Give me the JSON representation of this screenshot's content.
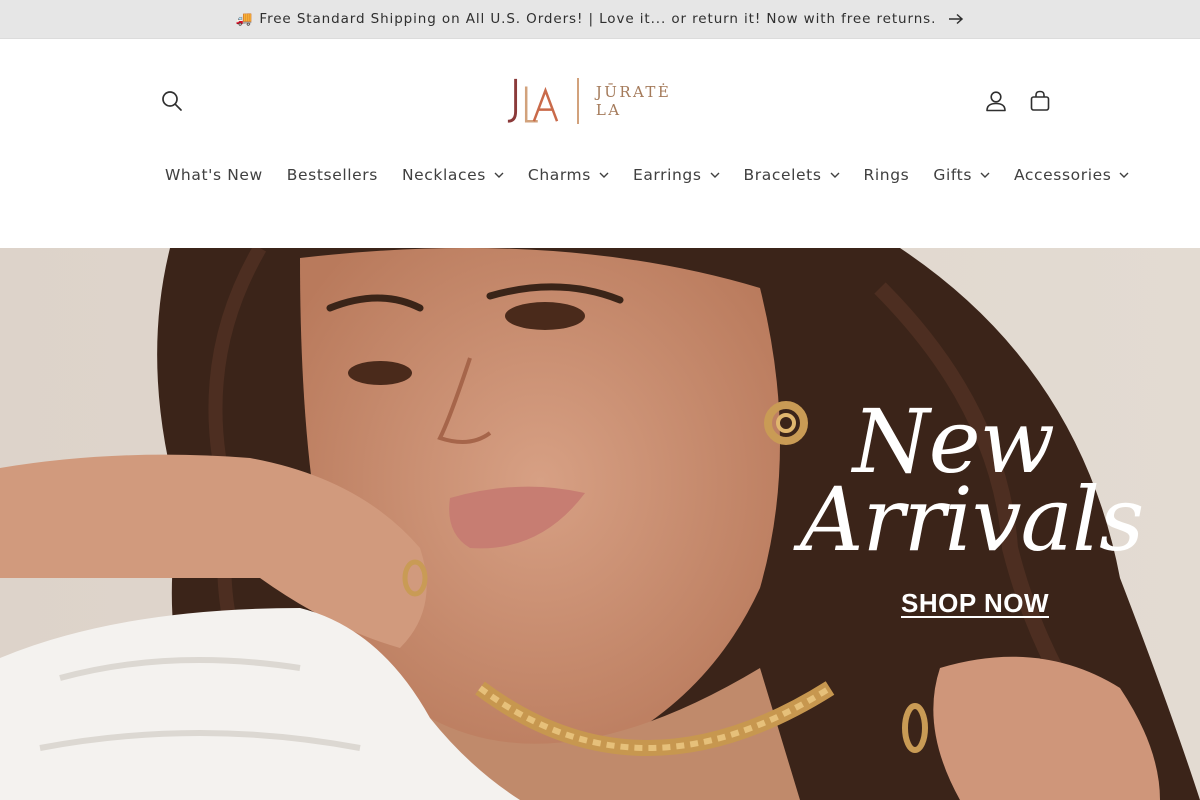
{
  "announcement": {
    "icon": "truck-icon",
    "text": "Free Standard Shipping on All U.S. Orders! | Love it... or return it! Now with free returns.",
    "truck_glyph": "🚚"
  },
  "header": {
    "logo_monogram": "JLA",
    "logo_wordmark": "JŪRATĖ LA",
    "icons": [
      "search-icon",
      "account-icon",
      "cart-icon"
    ]
  },
  "nav": {
    "items": [
      {
        "label": "What's New",
        "dropdown": false
      },
      {
        "label": "Bestsellers",
        "dropdown": false
      },
      {
        "label": "Necklaces",
        "dropdown": true
      },
      {
        "label": "Charms",
        "dropdown": true
      },
      {
        "label": "Earrings",
        "dropdown": true
      },
      {
        "label": "Bracelets",
        "dropdown": true
      },
      {
        "label": "Rings",
        "dropdown": false
      },
      {
        "label": "Gifts",
        "dropdown": true
      },
      {
        "label": "Accessories",
        "dropdown": true
      }
    ]
  },
  "hero": {
    "title_line1": "New",
    "title_line2": "Arrivals",
    "cta": "SHOP NOW"
  },
  "colors": {
    "announcement_bg": "#e6e6e6",
    "brand_accent": "#d2a27c",
    "logo_dark": "#8b3a3a",
    "text": "#404040"
  }
}
